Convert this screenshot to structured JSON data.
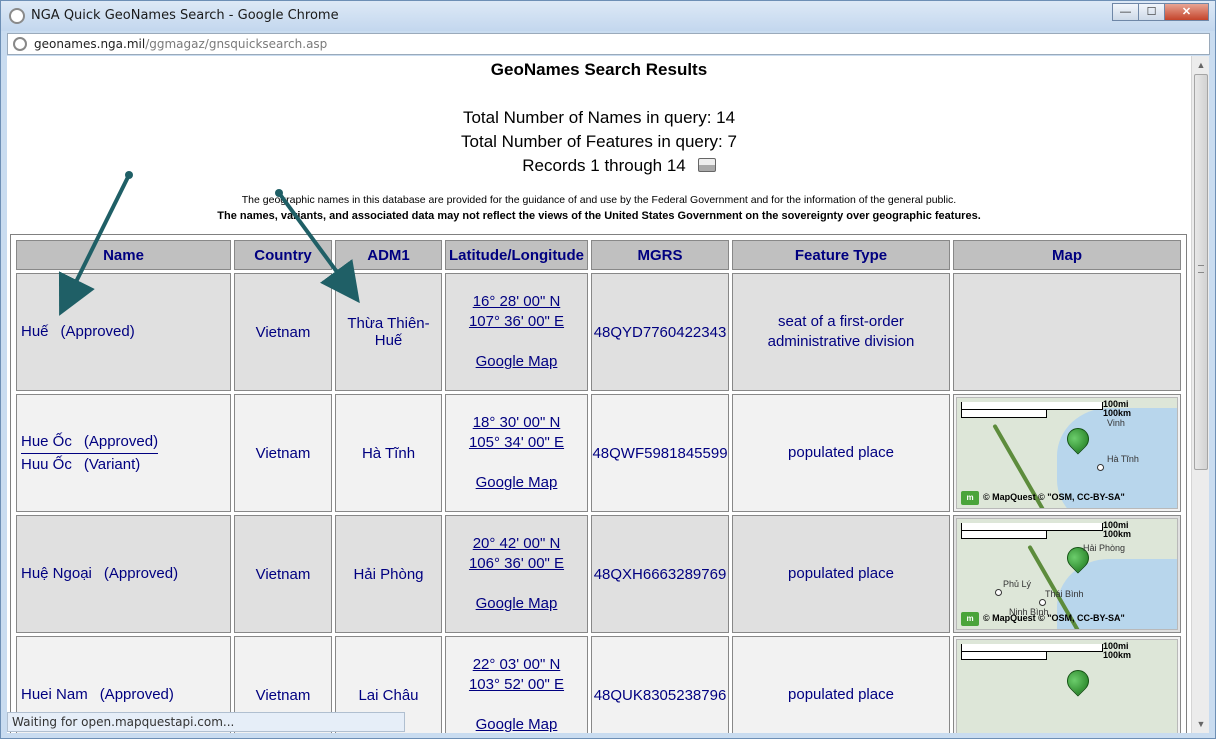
{
  "window": {
    "title": "NGA Quick GeoNames Search - Google Chrome",
    "controls": {
      "minimize": "—",
      "maximize": "☐",
      "close": "✕"
    }
  },
  "address": {
    "host": "geonames.nga.mil",
    "path": "/ggmagaz/gnsquicksearch.asp"
  },
  "page": {
    "title": "GeoNames Search Results",
    "total_names": "Total Number of Names in query: 14",
    "total_features": "Total Number of Features in query: 7",
    "records": "Records 1 through 14",
    "disclaimer": "The geographic names in this database are provided for the guidance of and use by the Federal Government and for the information of the general public.",
    "disclaimer_bold": "The names, variants, and associated data may not reflect the views of the United States Government on the sovereignty over geographic features."
  },
  "table": {
    "headers": [
      "Name",
      "Country",
      "ADM1",
      "Latitude/Longitude",
      "MGRS",
      "Feature Type",
      "Map"
    ],
    "google_map_label": "Google Map",
    "rows": [
      {
        "names": [
          {
            "name": "Huế",
            "status": "(Approved)"
          }
        ],
        "country": "Vietnam",
        "adm1": "Thừa Thiên-Huế",
        "lat": "16° 28' 00\" N",
        "lon": "107° 36' 00\" E",
        "mgrs": "48QYD7760422343",
        "feature": "seat of a first-order administrative division"
      },
      {
        "names": [
          {
            "name": "Hue Ốc",
            "status": "(Approved)"
          },
          {
            "name": "Huu Ốc",
            "status": "(Variant)"
          }
        ],
        "country": "Vietnam",
        "adm1": "Hà Tĩnh",
        "lat": "18° 30' 00\" N",
        "lon": "105° 34' 00\" E",
        "mgrs": "48QWF5981845599",
        "feature": "populated place",
        "map": {
          "cities": [
            "Vinh",
            "Hà Tĩnh"
          ]
        }
      },
      {
        "names": [
          {
            "name": "Huệ Ngoại",
            "status": "(Approved)"
          }
        ],
        "country": "Vietnam",
        "adm1": "Hải Phòng",
        "lat": "20° 42' 00\" N",
        "lon": "106° 36' 00\" E",
        "mgrs": "48QXH6663289769",
        "feature": "populated place",
        "map": {
          "cities": [
            "Hải Phòng",
            "Phủ Lý",
            "Thái Bình",
            "Ninh Bình"
          ]
        }
      },
      {
        "names": [
          {
            "name": "Huei Nam",
            "status": "(Approved)"
          }
        ],
        "country": "Vietnam",
        "adm1": "Lai Châu",
        "lat": "22° 03' 00\" N",
        "lon": "103° 52' 00\" E",
        "mgrs": "48QUK8305238796",
        "feature": "populated place",
        "map": {
          "cities": []
        }
      }
    ],
    "map_scale": {
      "mi": "100mi",
      "km": "100km"
    },
    "map_attribution": "© MapQuest © \"OSM, CC-BY-SA\"",
    "map_logo": "m"
  },
  "statusbar": "Waiting for open.mapquestapi.com...",
  "colors": {
    "link": "#000080",
    "header_bg": "#c0c0c0",
    "arrow": "#1f5f66"
  }
}
